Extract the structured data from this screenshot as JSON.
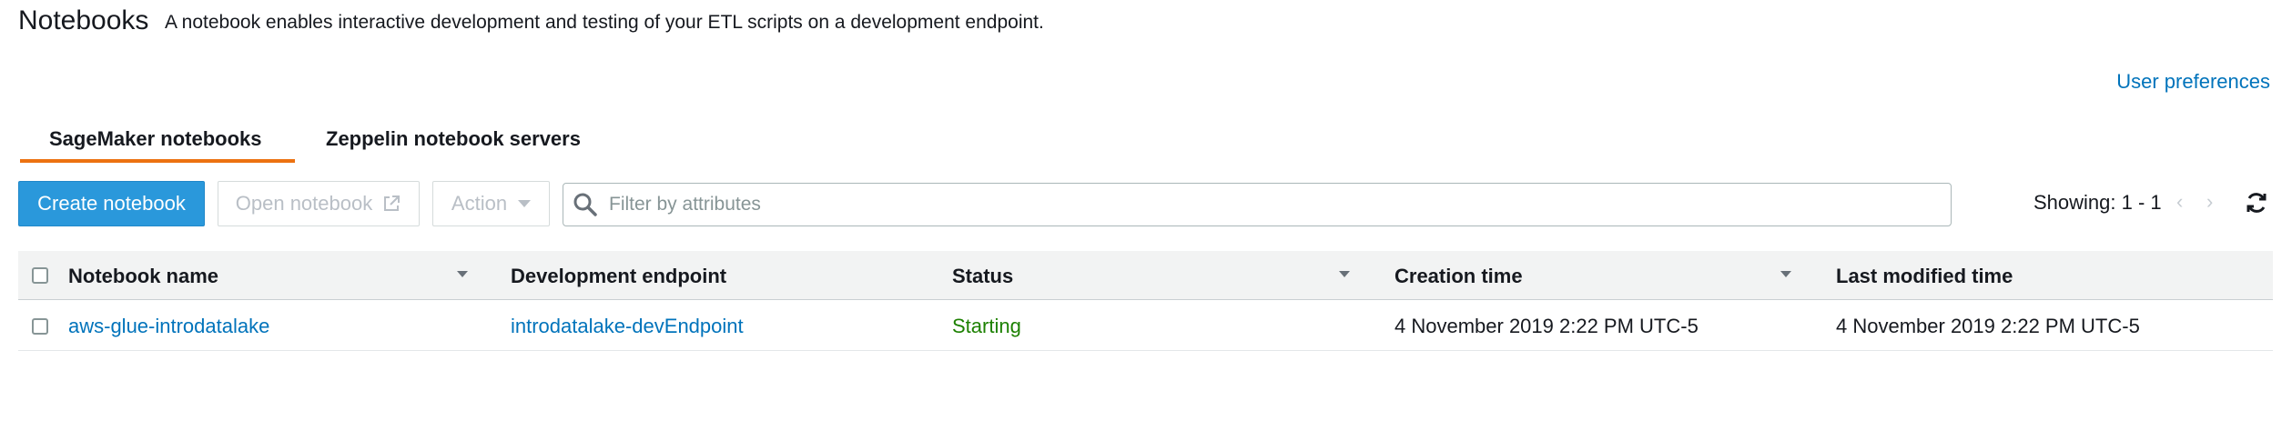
{
  "header": {
    "title": "Notebooks",
    "description": "A notebook enables interactive development and testing of your ETL scripts on a development endpoint.",
    "user_preferences": "User preferences"
  },
  "tabs": [
    {
      "label": "SageMaker notebooks",
      "selected": true
    },
    {
      "label": "Zeppelin notebook servers",
      "selected": false
    }
  ],
  "toolbar": {
    "create_label": "Create notebook",
    "open_label": "Open notebook",
    "action_label": "Action",
    "filter_placeholder": "Filter by attributes",
    "showing": "Showing: 1 - 1"
  },
  "icons": {
    "external_link": "external-link-icon",
    "caret": "caret-down-icon",
    "search": "search-icon",
    "prev": "chevron-left-icon",
    "next": "chevron-right-icon",
    "refresh": "refresh-icon"
  },
  "table": {
    "columns": [
      "Notebook name",
      "Development endpoint",
      "Status",
      "Creation time",
      "Last modified time"
    ],
    "rows": [
      {
        "name": "aws-glue-introdatalake",
        "endpoint": "introdatalake-devEndpoint",
        "status": "Starting",
        "created": "4 November 2019 2:22 PM UTC-5",
        "modified": "4 November 2019 2:22 PM UTC-5"
      }
    ]
  },
  "colors": {
    "accent": "#ec7211",
    "primary_button": "#2a98db",
    "link": "#0073bb",
    "status_starting": "#1d8102"
  }
}
